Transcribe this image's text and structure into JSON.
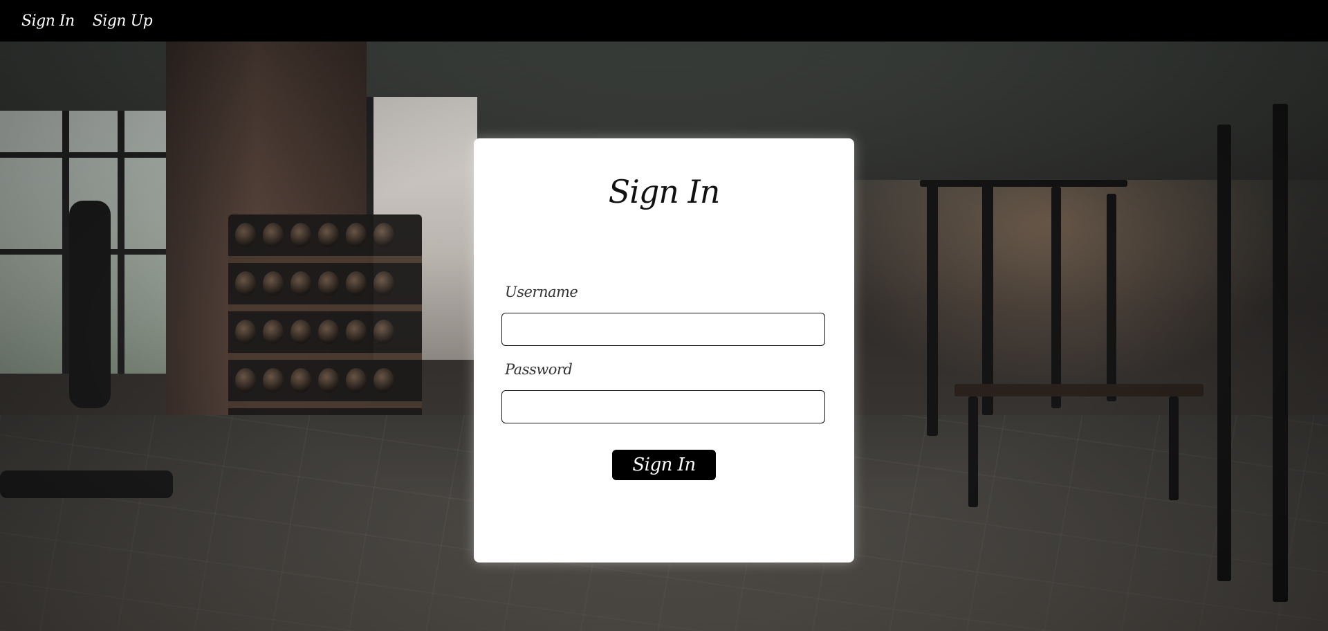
{
  "navbar": {
    "links": [
      {
        "label": "Sign In"
      },
      {
        "label": "Sign Up"
      }
    ]
  },
  "form": {
    "title": "Sign In",
    "username": {
      "label": "Username",
      "value": "",
      "placeholder": ""
    },
    "password": {
      "label": "Password",
      "value": "",
      "placeholder": ""
    },
    "submit_label": "Sign In"
  },
  "colors": {
    "navbar_bg": "#000000",
    "card_bg": "#ffffff",
    "button_bg": "#000000",
    "button_text": "#ffffff"
  },
  "background": {
    "icon": "gym-interior-photo"
  }
}
